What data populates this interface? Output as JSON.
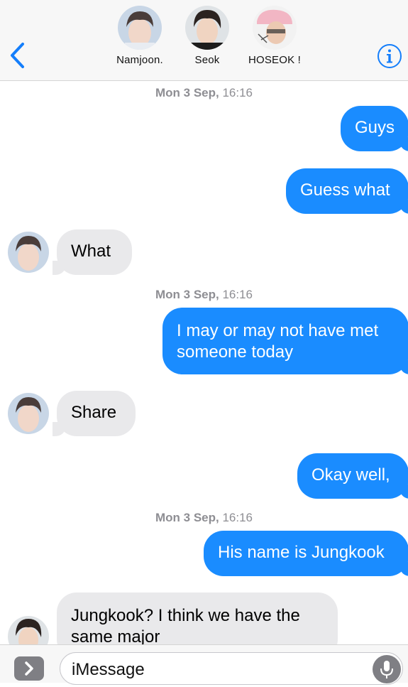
{
  "header": {
    "participants": [
      {
        "name": "Namjoon."
      },
      {
        "name": "Seok"
      },
      {
        "name": "HOSEOK !"
      }
    ]
  },
  "thread": {
    "timestamps": [
      {
        "day": "Mon 3 Sep,",
        "time": "16:16"
      },
      {
        "day": "Mon 3 Sep,",
        "time": "16:16"
      },
      {
        "day": "Mon 3 Sep,",
        "time": "16:16"
      }
    ],
    "messages": [
      {
        "text": "Guys"
      },
      {
        "text": "Guess what"
      },
      {
        "text": "What"
      },
      {
        "line1": "I may or may not have met",
        "line2": "someone today"
      },
      {
        "text": "Share"
      },
      {
        "text": "Okay well,"
      },
      {
        "text": "His name is Jungkook"
      },
      {
        "line1": "Jungkook? I think we have the",
        "line2": "same major"
      }
    ]
  },
  "input": {
    "placeholder": "iMessage"
  },
  "colors": {
    "outgoing_bubble": "#1a8cff",
    "incoming_bubble": "#e9e9eb",
    "ios_blue": "#147efb"
  }
}
